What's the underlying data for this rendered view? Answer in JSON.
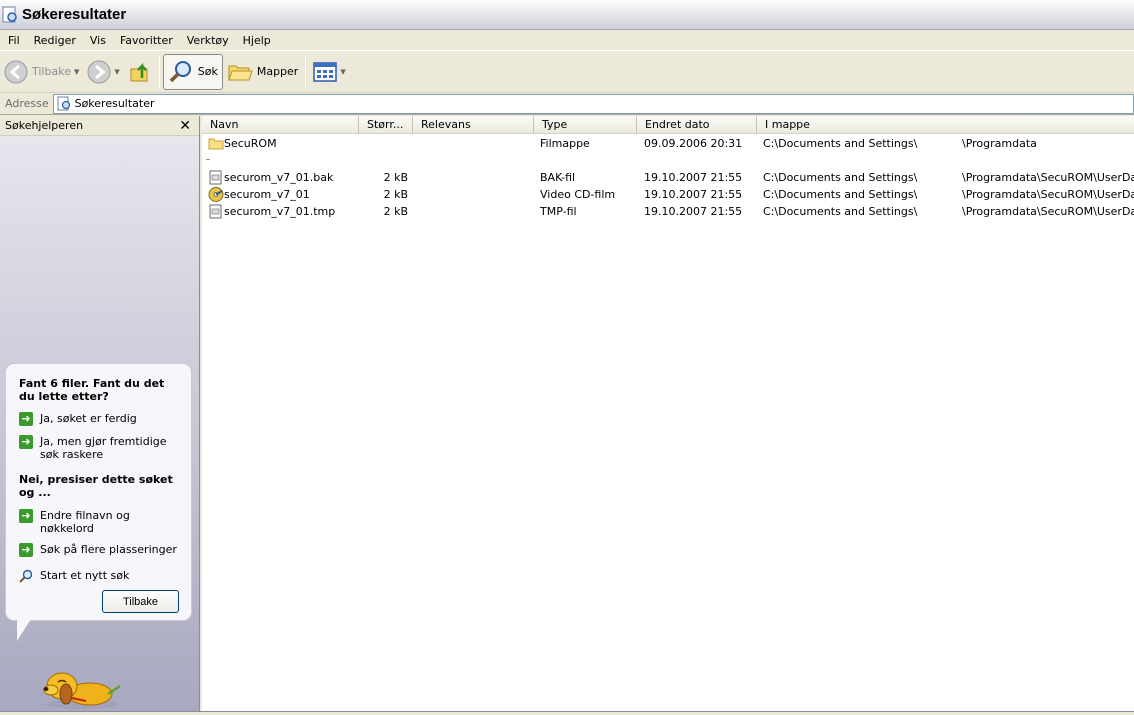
{
  "window": {
    "title": "Søkeresultater"
  },
  "menu": [
    "Fil",
    "Rediger",
    "Vis",
    "Favoritter",
    "Verktøy",
    "Hjelp"
  ],
  "toolbar": {
    "back_label": "Tilbake",
    "search_label": "Søk",
    "folders_label": "Mapper"
  },
  "address": {
    "label": "Adresse",
    "value": "Søkeresultater"
  },
  "search_pane": {
    "title": "Søkehjelperen",
    "question": "Fant 6 filer. Fant du det du lette etter?",
    "yes_done": "Ja, søket er ferdig",
    "yes_faster": "Ja, men gjør fremtidige søk raskere",
    "refine_heading": "Nei, presiser dette søket og ...",
    "change_name": "Endre filnavn og nøkkelord",
    "more_locations": "Søk på flere plasseringer",
    "new_search": "Start et nytt søk",
    "back_button": "Tilbake"
  },
  "columns": [
    "Navn",
    "Størr...",
    "Relevans",
    "Type",
    "Endret dato",
    "I mappe"
  ],
  "rows": [
    {
      "name": "SecuROM",
      "size": "",
      "type": "Filmappe",
      "date": "09.09.2006 20:31",
      "path1": "C:\\Documents and Settings\\",
      "path2": "\\Programdata",
      "icon": "folder-icon"
    },
    {
      "name": "securom_v7_01.bak",
      "size": "2 kB",
      "type": "BAK-fil",
      "date": "19.10.2007 21:55",
      "path1": "C:\\Documents and Settings\\",
      "path2": "\\Programdata\\SecuROM\\UserData",
      "icon": "file-icon"
    },
    {
      "name": "securom_v7_01",
      "size": "2 kB",
      "type": "Video CD-film",
      "date": "19.10.2007 21:55",
      "path1": "C:\\Documents and Settings\\",
      "path2": "\\Programdata\\SecuROM\\UserData",
      "icon": "cd-icon"
    },
    {
      "name": "securom_v7_01.tmp",
      "size": "2 kB",
      "type": "TMP-fil",
      "date": "19.10.2007 21:55",
      "path1": "C:\\Documents and Settings\\",
      "path2": "\\Programdata\\SecuROM\\UserData",
      "icon": "file-icon"
    }
  ],
  "colors": {
    "accent": "#3b9a2c",
    "link_border": "#003c74"
  }
}
